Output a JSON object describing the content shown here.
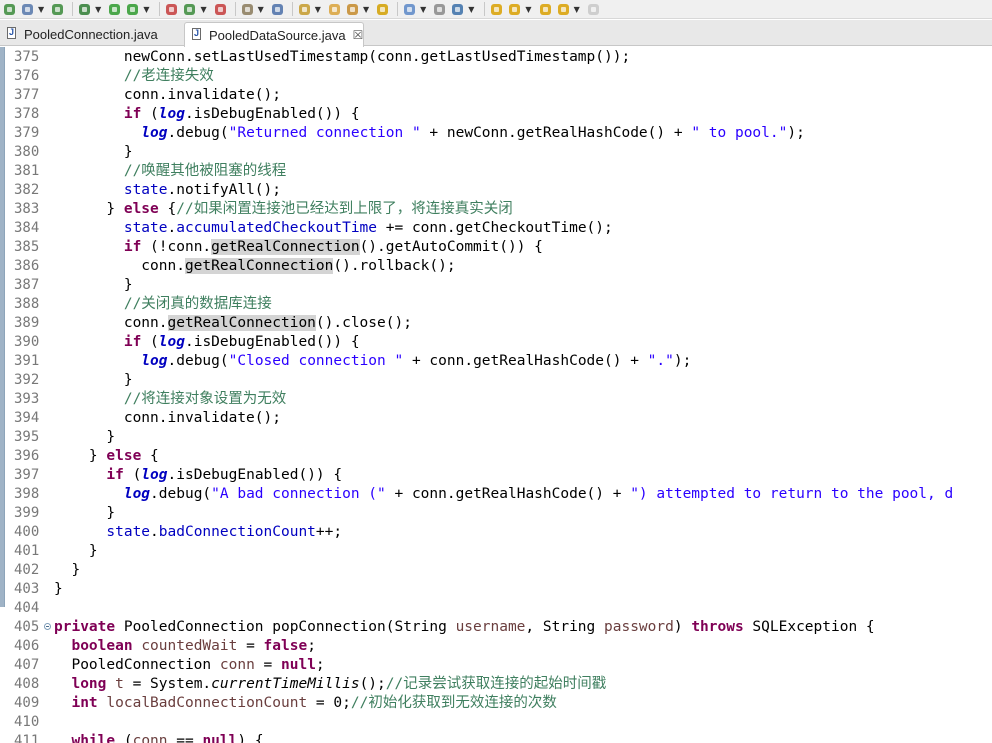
{
  "toolbar": {
    "buttons": [
      "new-icon",
      "save-icon",
      "refresh-icon",
      "debug-icon",
      "run-icon",
      "external-tools-icon",
      "terminate-icon",
      "coverage-icon",
      "build-icon",
      "server-icon",
      "search-icon",
      "open-type-icon",
      "open-resource-icon",
      "annotation-icon",
      "mark-occurrences-icon",
      "block-selection-icon",
      "whitespace-icon",
      "pin-icon",
      "next-annotation-icon",
      "prev-annotation-icon",
      "last-edit-icon",
      "back-icon",
      "forward-icon"
    ]
  },
  "tabs": [
    {
      "label": "PooledConnection.java",
      "active": false
    },
    {
      "label": "PooledDataSource.java",
      "active": true,
      "close": "☒"
    }
  ],
  "lines": [
    {
      "n": "375",
      "t": [
        {
          "x": "        newConn."
        },
        {
          "x": "setLastUsedTimestamp(conn.getLastUsedTimestamp());"
        }
      ]
    },
    {
      "n": "376",
      "t": [
        {
          "x": "        "
        },
        {
          "x": "//老连接失效",
          "c": "cm"
        }
      ]
    },
    {
      "n": "377",
      "t": [
        {
          "x": "        conn.invalidate();"
        }
      ]
    },
    {
      "n": "378",
      "t": [
        {
          "x": "        "
        },
        {
          "x": "if",
          "c": "kw"
        },
        {
          "x": " ("
        },
        {
          "x": "log",
          "c": "stfld"
        },
        {
          "x": ".isDebugEnabled()) {"
        }
      ]
    },
    {
      "n": "379",
      "t": [
        {
          "x": "          "
        },
        {
          "x": "log",
          "c": "stfld"
        },
        {
          "x": ".debug("
        },
        {
          "x": "\"Returned connection \"",
          "c": "str"
        },
        {
          "x": " + newConn.getRealHashCode() + "
        },
        {
          "x": "\" to pool.\"",
          "c": "str"
        },
        {
          "x": ");"
        }
      ]
    },
    {
      "n": "380",
      "t": [
        {
          "x": "        }"
        }
      ]
    },
    {
      "n": "381",
      "t": [
        {
          "x": "        "
        },
        {
          "x": "//唤醒其他被阻塞的线程",
          "c": "cm"
        }
      ]
    },
    {
      "n": "382",
      "t": [
        {
          "x": "        "
        },
        {
          "x": "state",
          "c": "fld"
        },
        {
          "x": ".notifyAll();"
        }
      ]
    },
    {
      "n": "383",
      "t": [
        {
          "x": "      } "
        },
        {
          "x": "else",
          "c": "kw"
        },
        {
          "x": " {"
        },
        {
          "x": "//如果闲置连接池已经达到上限了，将连接真实关闭",
          "c": "cm"
        }
      ]
    },
    {
      "n": "384",
      "t": [
        {
          "x": "        "
        },
        {
          "x": "state",
          "c": "fld"
        },
        {
          "x": "."
        },
        {
          "x": "accumulatedCheckoutTime",
          "c": "fld"
        },
        {
          "x": " += conn.getCheckoutTime();"
        }
      ]
    },
    {
      "n": "385",
      "t": [
        {
          "x": "        "
        },
        {
          "x": "if",
          "c": "kw"
        },
        {
          "x": " (!conn."
        },
        {
          "x": "getRealConnection",
          "c": "hl"
        },
        {
          "x": "().getAutoCommit()) {"
        }
      ]
    },
    {
      "n": "386",
      "t": [
        {
          "x": "          conn."
        },
        {
          "x": "getRealConnection",
          "c": "hl"
        },
        {
          "x": "().rollback();"
        }
      ]
    },
    {
      "n": "387",
      "t": [
        {
          "x": "        }"
        }
      ]
    },
    {
      "n": "388",
      "t": [
        {
          "x": "        "
        },
        {
          "x": "//关闭真的数据库连接",
          "c": "cm"
        }
      ]
    },
    {
      "n": "389",
      "t": [
        {
          "x": "        conn."
        },
        {
          "x": "getRealConnection",
          "c": "hl"
        },
        {
          "x": "().close();"
        }
      ]
    },
    {
      "n": "390",
      "t": [
        {
          "x": "        "
        },
        {
          "x": "if",
          "c": "kw"
        },
        {
          "x": " ("
        },
        {
          "x": "log",
          "c": "stfld"
        },
        {
          "x": ".isDebugEnabled()) {"
        }
      ]
    },
    {
      "n": "391",
      "t": [
        {
          "x": "          "
        },
        {
          "x": "log",
          "c": "stfld"
        },
        {
          "x": ".debug("
        },
        {
          "x": "\"Closed connection \"",
          "c": "str"
        },
        {
          "x": " + conn.getRealHashCode() + "
        },
        {
          "x": "\".\"",
          "c": "str"
        },
        {
          "x": ");"
        }
      ]
    },
    {
      "n": "392",
      "t": [
        {
          "x": "        }"
        }
      ]
    },
    {
      "n": "393",
      "t": [
        {
          "x": "        "
        },
        {
          "x": "//将连接对象设置为无效",
          "c": "cm"
        }
      ]
    },
    {
      "n": "394",
      "t": [
        {
          "x": "        conn.invalidate();"
        }
      ]
    },
    {
      "n": "395",
      "t": [
        {
          "x": "      }"
        }
      ]
    },
    {
      "n": "396",
      "t": [
        {
          "x": "    } "
        },
        {
          "x": "else",
          "c": "kw"
        },
        {
          "x": " {"
        }
      ]
    },
    {
      "n": "397",
      "t": [
        {
          "x": "      "
        },
        {
          "x": "if",
          "c": "kw"
        },
        {
          "x": " ("
        },
        {
          "x": "log",
          "c": "stfld"
        },
        {
          "x": ".isDebugEnabled()) {"
        }
      ]
    },
    {
      "n": "398",
      "t": [
        {
          "x": "        "
        },
        {
          "x": "log",
          "c": "stfld"
        },
        {
          "x": ".debug("
        },
        {
          "x": "\"A bad connection (\"",
          "c": "str"
        },
        {
          "x": " + conn.getRealHashCode() + "
        },
        {
          "x": "\") attempted to return to the pool, d",
          "c": "str"
        }
      ]
    },
    {
      "n": "399",
      "t": [
        {
          "x": "      }"
        }
      ]
    },
    {
      "n": "400",
      "t": [
        {
          "x": "      "
        },
        {
          "x": "state",
          "c": "fld"
        },
        {
          "x": "."
        },
        {
          "x": "badConnectionCount",
          "c": "fld"
        },
        {
          "x": "++;"
        }
      ]
    },
    {
      "n": "401",
      "t": [
        {
          "x": "    }"
        }
      ]
    },
    {
      "n": "402",
      "t": [
        {
          "x": "  }"
        }
      ]
    },
    {
      "n": "403",
      "t": [
        {
          "x": "}"
        }
      ]
    },
    {
      "n": "404",
      "t": [
        {
          "x": ""
        }
      ]
    },
    {
      "n": "405",
      "fold": true,
      "t": [
        {
          "x": "private",
          "c": "kw"
        },
        {
          "x": " PooledConnection popConnection(String "
        },
        {
          "x": "username",
          "c": "var"
        },
        {
          "x": ", String "
        },
        {
          "x": "password",
          "c": "var"
        },
        {
          "x": ") "
        },
        {
          "x": "throws",
          "c": "kw"
        },
        {
          "x": " SQLException {"
        }
      ]
    },
    {
      "n": "406",
      "t": [
        {
          "x": "  "
        },
        {
          "x": "boolean",
          "c": "kw"
        },
        {
          "x": " "
        },
        {
          "x": "countedWait",
          "c": "var"
        },
        {
          "x": " = "
        },
        {
          "x": "false",
          "c": "kw"
        },
        {
          "x": ";"
        }
      ]
    },
    {
      "n": "407",
      "t": [
        {
          "x": "  PooledConnection "
        },
        {
          "x": "conn",
          "c": "var"
        },
        {
          "x": " = "
        },
        {
          "x": "null",
          "c": "kw"
        },
        {
          "x": ";"
        }
      ]
    },
    {
      "n": "408",
      "t": [
        {
          "x": "  "
        },
        {
          "x": "long",
          "c": "kw"
        },
        {
          "x": " "
        },
        {
          "x": "t",
          "c": "var"
        },
        {
          "x": " = System."
        },
        {
          "x": "currentTimeMillis",
          "c": "stm"
        },
        {
          "x": "();"
        },
        {
          "x": "//记录尝试获取连接的起始时间戳",
          "c": "cm"
        }
      ]
    },
    {
      "n": "409",
      "t": [
        {
          "x": "  "
        },
        {
          "x": "int",
          "c": "kw"
        },
        {
          "x": " "
        },
        {
          "x": "localBadConnectionCount",
          "c": "var"
        },
        {
          "x": " = 0;"
        },
        {
          "x": "//初始化获取到无效连接的次数",
          "c": "cm"
        }
      ]
    },
    {
      "n": "410",
      "t": [
        {
          "x": ""
        }
      ]
    },
    {
      "n": "411",
      "t": [
        {
          "x": "  "
        },
        {
          "x": "while",
          "c": "kw"
        },
        {
          "x": " ("
        },
        {
          "x": "conn",
          "c": "var"
        },
        {
          "x": " == "
        },
        {
          "x": "null",
          "c": "kw"
        },
        {
          "x": ") {"
        }
      ]
    }
  ]
}
